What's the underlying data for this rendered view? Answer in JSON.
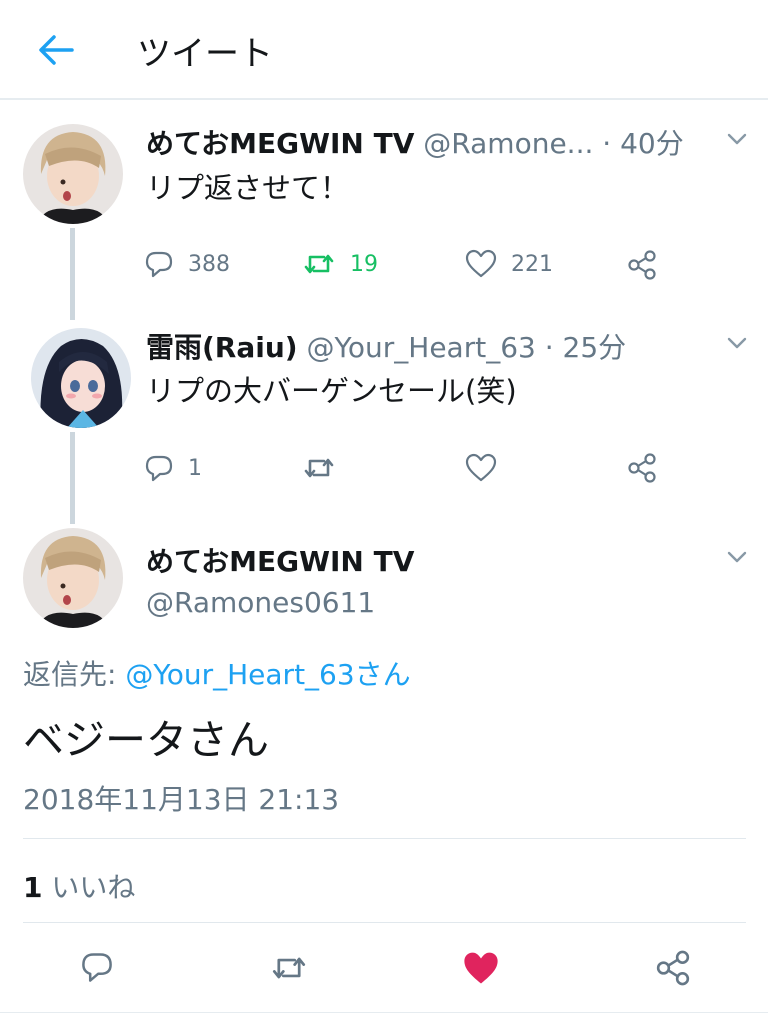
{
  "header": {
    "title": "ツイート",
    "back_icon": "arrow-left-icon"
  },
  "tweets": [
    {
      "display_name": "めておMEGWIN TV",
      "handle": "@Ramone...",
      "time": "· 40分",
      "text": "リプ返させて！",
      "reply_count": "388",
      "retweet_count": "19",
      "like_count": "221"
    },
    {
      "display_name": "雷雨(Raiu)",
      "handle": "@Your_Heart_63",
      "time": "· 25分",
      "text": "リプの大バーゲンセール(笑)",
      "reply_count": "1",
      "retweet_count": "",
      "like_count": ""
    }
  ],
  "main_tweet": {
    "display_name": "めておMEGWIN TV",
    "handle": "@Ramones0611",
    "reply_to_prefix": "返信先: ",
    "reply_to_handle": "@Your_Heart_63さん",
    "text": "ベジータさん",
    "timestamp": "2018年11月13日 21:13",
    "likes_count": "1",
    "likes_label": "いいね"
  },
  "colors": {
    "accent": "#1da1f2",
    "retweet_active": "#17bf63",
    "like_active": "#e0245e",
    "secondary_text": "#657786"
  }
}
